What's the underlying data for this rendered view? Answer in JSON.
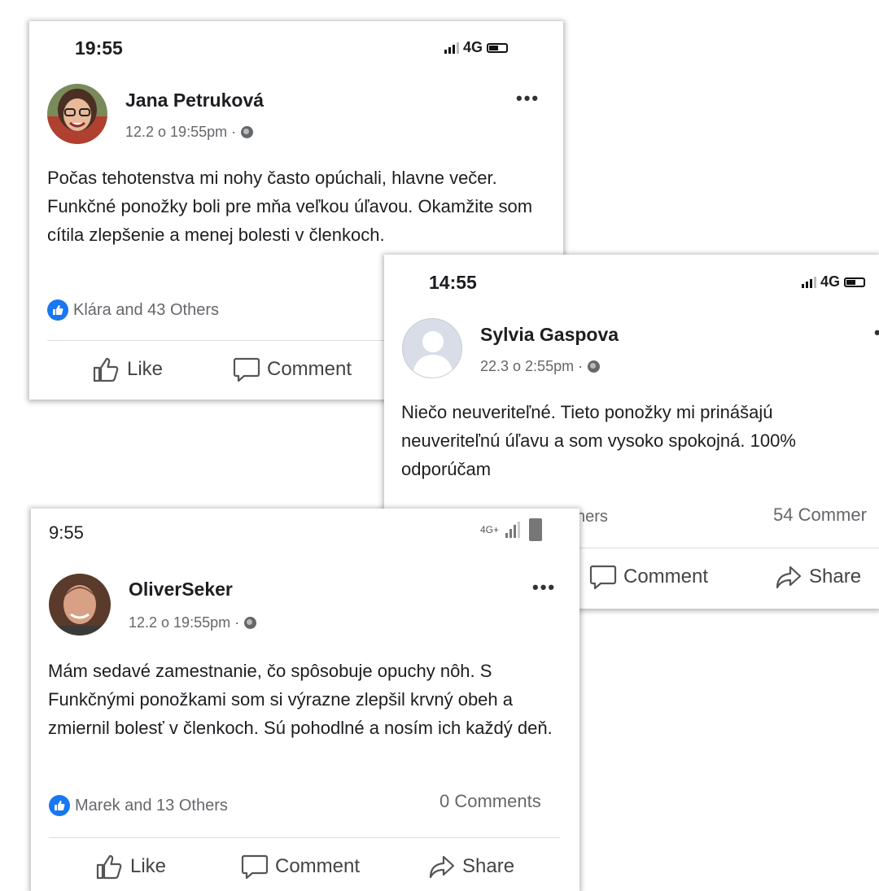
{
  "posts": [
    {
      "time": "19:55",
      "network": "4G",
      "author": "Jana Petruková",
      "date": "12.2 o 19:55pm ·",
      "text": "Počas tehotenstva mi nohy často opúchali, hlavne večer. Funkčné ponožky boli pre mňa veľkou úľavou. Okamžite som cítila zlepšenie a menej bolesti v členkoch.",
      "reactions": "Klára and 43 Others",
      "like_label": "Like",
      "comment_label": "Comment"
    },
    {
      "time": "14:55",
      "network": "4G",
      "author": "Sylvia Gaspova",
      "date": "22.3 o 2:55pm ·",
      "text": "Niečo neuveriteľné. Tieto ponožky mi prinášajú neuveriteľnú úľavu a som vysoko spokojná. 100% odporúčam",
      "reactions_partial": "hers",
      "comments": "54 Commer",
      "comment_label": "Comment",
      "share_label": "Share"
    },
    {
      "time": "9:55",
      "network": "4G+",
      "author": "OliverSeker",
      "date": "12.2 o 19:55pm ·",
      "text": "Mám sedavé zamestnanie, čo spôsobuje opuchy nôh. S Funkčnými ponožkami som si výrazne zlepšil krvný obeh a zmiernil bolesť v členkoch. Sú pohodlné a nosím ich každý deň.",
      "reactions": "Marek and 13 Others",
      "comments": "0 Comments",
      "like_label": "Like",
      "comment_label": "Comment",
      "share_label": "Share"
    }
  ],
  "colors": {
    "accent": "#1877f2",
    "muted": "#65676b",
    "text": "#1c1e21"
  }
}
